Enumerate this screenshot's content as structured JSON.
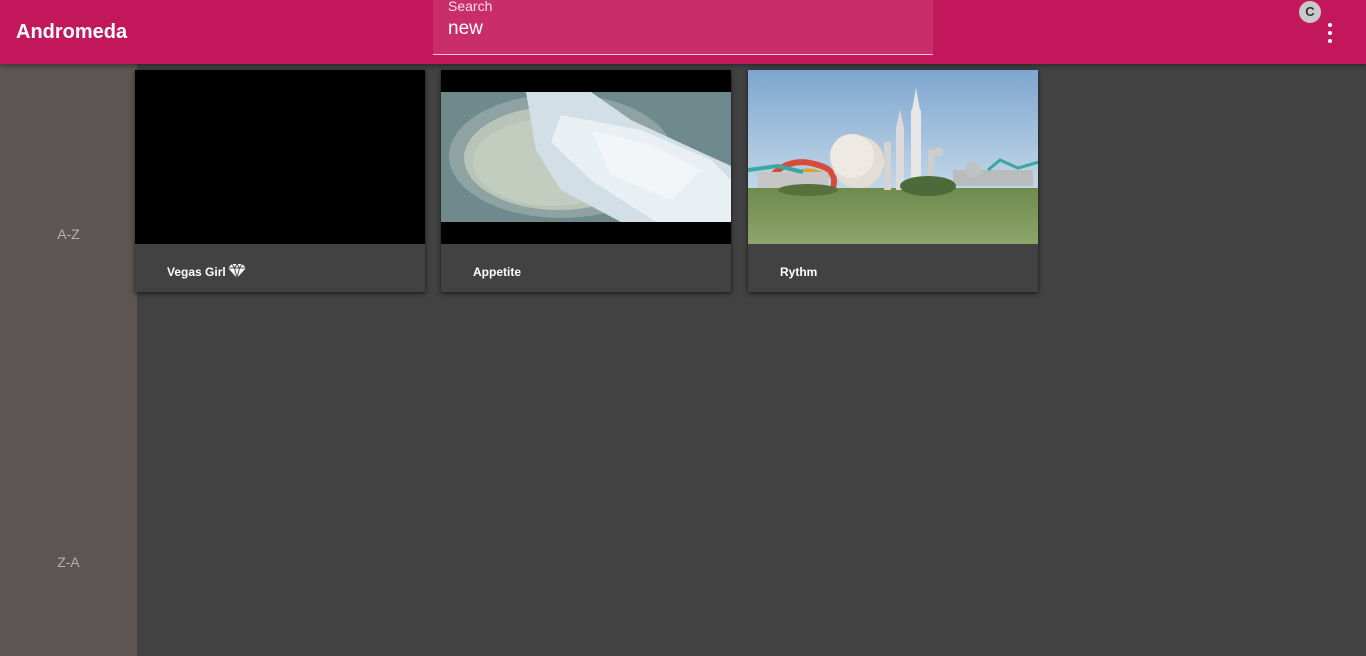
{
  "app": {
    "title": "Andromeda",
    "accent_color": "#c2185b"
  },
  "search": {
    "label": "Search",
    "value": "new"
  },
  "user": {
    "avatar_initial": "C"
  },
  "header": {
    "menu_icon": "more-vert-icon"
  },
  "sidebar": {
    "sort_options": [
      {
        "label": "A-Z"
      },
      {
        "label": "Z-A"
      }
    ]
  },
  "cards": [
    {
      "title": "Vegas Girl",
      "badge_icon": "diamond-icon"
    },
    {
      "title": "Appetite"
    },
    {
      "title": "Rythm"
    }
  ]
}
